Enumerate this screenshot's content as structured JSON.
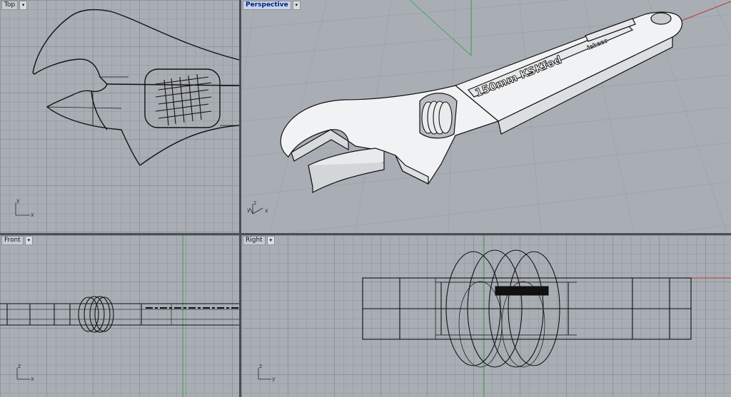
{
  "viewports": {
    "top": {
      "label": "Top",
      "axes": [
        "y",
        "x"
      ]
    },
    "perspective": {
      "label": "Perspective",
      "axes": [
        "z",
        "y",
        "x"
      ],
      "engraving_main": "150mm KSKfod",
      "engraving_small": "ieheeo"
    },
    "front": {
      "label": "Front",
      "axes": [
        "z",
        "x"
      ]
    },
    "right": {
      "label": "Right",
      "axes": [
        "z",
        "y"
      ]
    }
  },
  "icons": {
    "dropdown": "chevron-down-icon"
  },
  "colors": {
    "viewport_bg": "#a9aeb5",
    "grid_line": "#9ca1a8",
    "axis_x": "#c0392b",
    "axis_y": "#2ea043",
    "geometry": "#111111",
    "active_label": "#00227a"
  }
}
